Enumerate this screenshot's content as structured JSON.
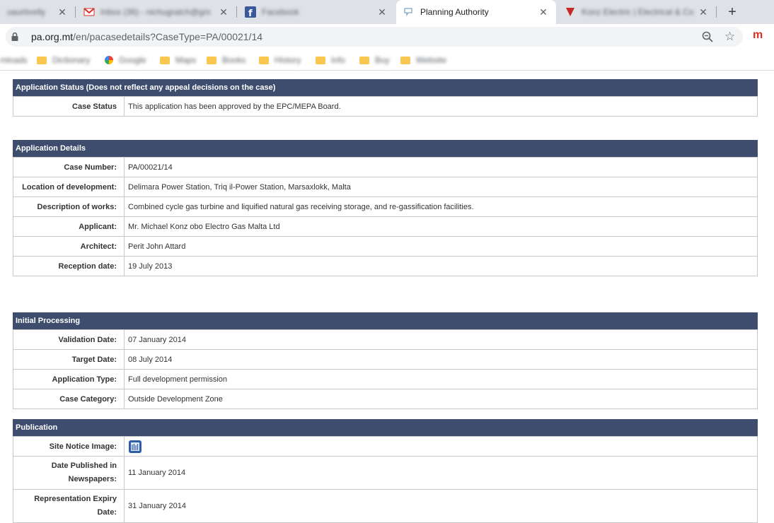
{
  "browser": {
    "tabs": [
      {
        "label": "uaurtivelly"
      },
      {
        "label": "Inbox (36) - nichugratch@gm"
      },
      {
        "label": "Facebook"
      },
      {
        "label": "Planning Authority"
      },
      {
        "label": "Konz Electric | Electrical & Co"
      }
    ],
    "url_host": "pa.org.mt",
    "url_path": "/en/pacasedetails?CaseType=PA/00021/14",
    "bookmarks": [
      {
        "label": "mloads"
      },
      {
        "label": "Dictionary"
      },
      {
        "label": "Google"
      },
      {
        "label": "Maps"
      },
      {
        "label": "Books"
      },
      {
        "label": "History"
      },
      {
        "label": "Info"
      },
      {
        "label": "Buy"
      },
      {
        "label": "Website"
      }
    ]
  },
  "status": {
    "header": "Application Status (Does not reflect any appeal decisions on the case)",
    "rows": [
      {
        "label": "Case Status",
        "value": "This application has been approved by the EPC/MEPA Board."
      }
    ]
  },
  "details": {
    "header": "Application Details",
    "rows": [
      {
        "label": "Case Number:",
        "value": "PA/00021/14"
      },
      {
        "label": "Location of development:",
        "value": "Delimara Power Station, Triq il-Power Station, Marsaxlokk, Malta"
      },
      {
        "label": "Description of works:",
        "value": "Combined cycle gas turbine and liquified natural gas receiving storage, and re-gassification facilities."
      },
      {
        "label": "Applicant:",
        "value": "Mr. Michael Konz obo Electro Gas Malta Ltd"
      },
      {
        "label": "Architect:",
        "value": "Perit John Attard"
      },
      {
        "label": "Reception date:",
        "value": "19 July 2013"
      }
    ]
  },
  "processing": {
    "header": "Initial Processing",
    "rows": [
      {
        "label": "Validation Date:",
        "value": "07 January 2014"
      },
      {
        "label": "Target Date:",
        "value": "08 July 2014"
      },
      {
        "label": "Application Type:",
        "value": "Full development permission"
      },
      {
        "label": "Case Category:",
        "value": "Outside Development Zone"
      }
    ]
  },
  "publication": {
    "header": "Publication",
    "site_notice_label": "Site Notice Image:",
    "newspapers_label": "Date Published in Newspapers:",
    "newspapers_value": "11 January 2014",
    "expiry_label": "Representation Expiry Date:",
    "expiry_value": "31 January 2014"
  },
  "colors": {
    "header_bg": "#3e4d6e",
    "border": "#c8c8c8"
  }
}
